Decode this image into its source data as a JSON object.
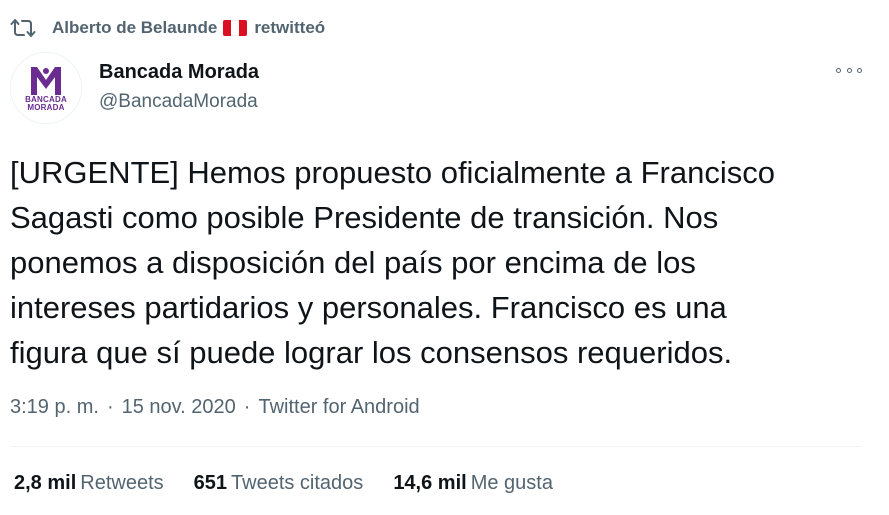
{
  "retweet_context": {
    "name": "Alberto de Belaunde",
    "action": "retwitteó"
  },
  "author": {
    "display_name": "Bancada Morada",
    "handle": "@BancadaMorada",
    "avatar_letter": "M",
    "avatar_line1": "BANCADA",
    "avatar_line2": "MORADA"
  },
  "tweet": {
    "text": "[URGENTE] Hemos propuesto oficialmente a Francisco\nSagasti como posible Presidente de transición. Nos\nponemos a disposición del país por encima de los\nintereses partidarios y personales. Francisco es una\nfigura que sí puede lograr los consensos requeridos.",
    "time": "3:19 p. m.",
    "date": "15 nov. 2020",
    "source": "Twitter for Android",
    "separator": "·"
  },
  "stats": {
    "retweets_count": "2,8 mil",
    "retweets_label": "Retweets",
    "quotes_count": "651",
    "quotes_label": "Tweets citados",
    "likes_count": "14,6 mil",
    "likes_label": "Me gusta"
  },
  "colors": {
    "brand_purple": "#6a2c91",
    "secondary_text": "#536471",
    "primary_text": "#0f1419",
    "flag_red": "#d91023"
  }
}
